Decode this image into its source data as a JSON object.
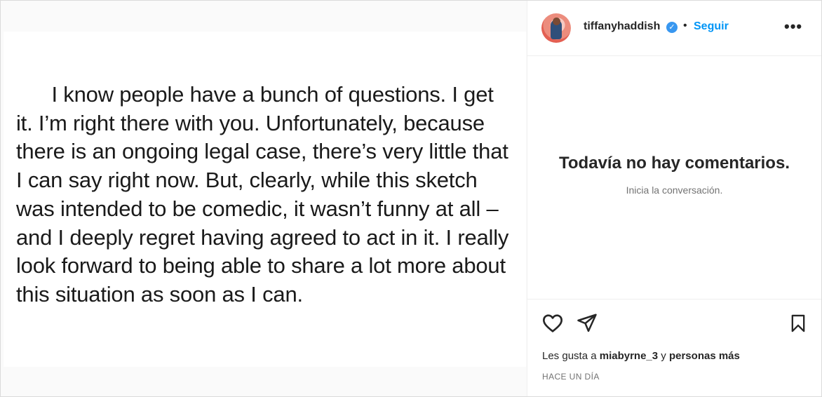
{
  "post": {
    "text": "      I know people have a bunch of questions. I get it. I’m right there with you. Unfortunately, because there is an ongoing legal case, there’s very little that I can say right now. But, clearly, while this sketch was intended to be comedic, it wasn’t funny at all – and I deeply regret having agreed to act in it. I really look forward to being able to share a lot more about this situation as soon as I can."
  },
  "header": {
    "username": "tiffanyhaddish",
    "verified_mark": "✓",
    "separator": "•",
    "follow_label": "Seguir",
    "more_label": "•••"
  },
  "comments": {
    "empty_title": "Todavía no hay comentarios.",
    "empty_subtitle": "Inicia la conversación."
  },
  "likes": {
    "prefix": "Les gusta a ",
    "user": "miabyrne_3",
    "middle": " y ",
    "others": "personas más"
  },
  "timestamp": "HACE UN DÍA",
  "icons": {
    "like": "heart-icon",
    "share": "paper-plane-icon",
    "save": "bookmark-icon",
    "verified": "verified-badge-icon"
  },
  "colors": {
    "accent": "#0095f6",
    "verified": "#3897f0",
    "text": "#262626",
    "muted": "#737373"
  }
}
